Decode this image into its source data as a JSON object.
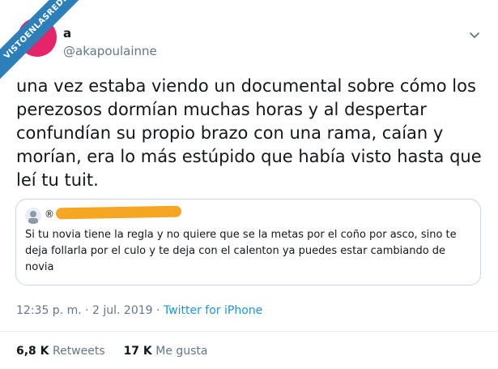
{
  "watermark": "VISTOENLASREDES",
  "author": {
    "display_name": "a",
    "handle": "@akapoulainne",
    "avatar_color": "#e6246a"
  },
  "tweet": {
    "text": "una vez estaba viendo un documental sobre cómo los perezosos dormían muchas horas y al despertar confundían su propio brazo con una rama, caían y morían, era lo más estúpido que había visto hasta que leí tu tuit."
  },
  "quoted": {
    "mark": "®",
    "text": "Si tu novia tiene la regla y no quiere que se la metas por el coño por asco, sino te deja follarla por el culo y te deja con el calenton ya puedes estar cambiando de novia"
  },
  "meta": {
    "timestamp": "12:35 p. m. · 2 jul. 2019 · ",
    "source": "Twitter for iPhone"
  },
  "stats": {
    "retweets_count": "6,8 K",
    "retweets_label": "Retweets",
    "likes_count": "17 K",
    "likes_label": "Me gusta"
  },
  "colors": {
    "accent": "#1b95e0",
    "redaction": "#f5a623",
    "watermark": "#2c7fb8"
  }
}
